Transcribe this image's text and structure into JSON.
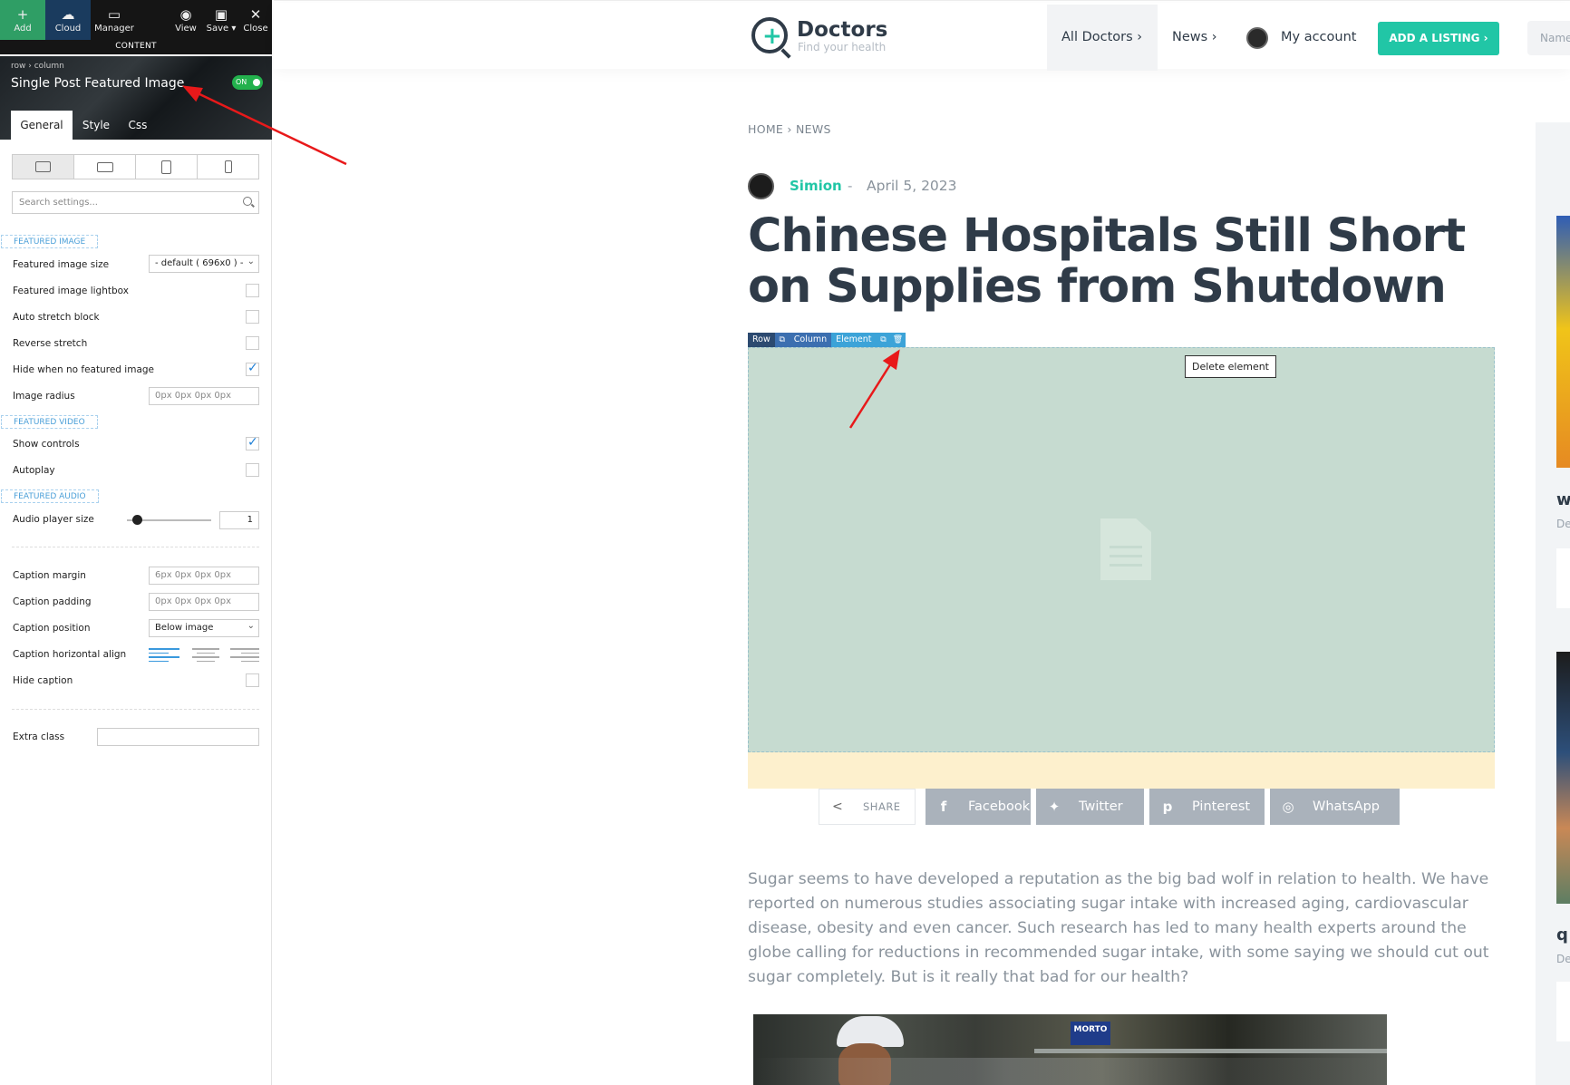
{
  "toolbar": {
    "add": "Add",
    "cloud": "Cloud",
    "manager": "Manager",
    "view": "View",
    "save": "Save",
    "close": "Close",
    "content": "CONTENT"
  },
  "element": {
    "breadcrumb": "row  ›  column",
    "title": "Single Post Featured Image",
    "toggle": "ON"
  },
  "tabs": [
    "General",
    "Style",
    "Css"
  ],
  "search_placeholder": "Search settings...",
  "sections": {
    "image": "FEATURED IMAGE",
    "video": "FEATURED VIDEO",
    "audio": "FEATURED AUDIO"
  },
  "settings": {
    "image_size_label": "Featured image size",
    "image_size_value": "- default ( 696x0 ) -",
    "lightbox_label": "Featured image lightbox",
    "stretch_label": "Auto stretch block",
    "reverse_label": "Reverse stretch",
    "hide_no_img_label": "Hide when no featured image",
    "radius_label": "Image radius",
    "radius_placeholder": "0px 0px 0px 0px",
    "controls_label": "Show controls",
    "autoplay_label": "Autoplay",
    "audio_size_label": "Audio player size",
    "audio_size_value": "1",
    "audio_size_fraction": 0.12,
    "cap_margin_label": "Caption margin",
    "cap_margin_placeholder": "6px 0px 0px 0px",
    "cap_padding_label": "Caption padding",
    "cap_padding_placeholder": "0px 0px 0px 0px",
    "cap_position_label": "Caption position",
    "cap_position_value": "Below image",
    "cap_align_label": "Caption horizontal align",
    "hide_caption_label": "Hide caption",
    "extra_class_label": "Extra class",
    "checked": {
      "lightbox": false,
      "stretch": false,
      "reverse": false,
      "hide_no_img": true,
      "controls": true,
      "autoplay": false,
      "hide_caption": false
    }
  },
  "site": {
    "logo_name": "Doctors",
    "logo_tagline": "Find your health",
    "nav_all_doctors": "All Doctors  ›",
    "nav_news": "News  ›",
    "nav_account": "My account",
    "add_listing": "ADD A LISTING  ›",
    "search_placeholder": "Name"
  },
  "post": {
    "breadcrumb": "HOME › NEWS",
    "author": "Simion",
    "separator": "-",
    "date": "April 5, 2023",
    "title": "Chinese Hospitals Still Short on Supplies from Shutdown",
    "body": "Sugar seems to have developed a reputation as the big bad wolf in relation to health. We have reported on numerous studies associating sugar intake with increased aging, cardiovascular disease, obesity and even cancer. Such research has led to many health experts around the globe calling for reductions in recommended sugar intake, with some saying we should cut out sugar completely. But is it really that bad for our health?"
  },
  "builder": {
    "row": "Row",
    "column": "Column",
    "element": "Element",
    "tooltip": "Delete element"
  },
  "share": {
    "label": "SHARE",
    "facebook": "Facebook",
    "twitter": "Twitter",
    "pinterest": "Pinterest",
    "whatsapp": "WhatsApp"
  },
  "photo_sign": "MORTO",
  "sidebar_fragments": {
    "t1": "w",
    "s1": "De",
    "t2": "q",
    "s2": "De"
  },
  "colors": {
    "accent": "#21c6a6",
    "dark": "#2f3b48",
    "placeholder": "#c6dbd0",
    "caption_bg": "#fdf0cd",
    "share_btn": "#aab2bb",
    "toggle_on": "#23b14d",
    "annotation_arrow": "#e8191a"
  },
  "icons": [
    "add-icon",
    "cloud-icon",
    "manager-icon",
    "eye-icon",
    "save-icon",
    "close-icon",
    "desktop-icon",
    "tablet-landscape-icon",
    "tablet-portrait-icon",
    "phone-icon",
    "search-icon",
    "chevron-down-icon",
    "share-icon",
    "facebook-icon",
    "twitter-icon",
    "pinterest-icon",
    "whatsapp-icon",
    "document-icon",
    "copy-icon",
    "trash-icon"
  ]
}
